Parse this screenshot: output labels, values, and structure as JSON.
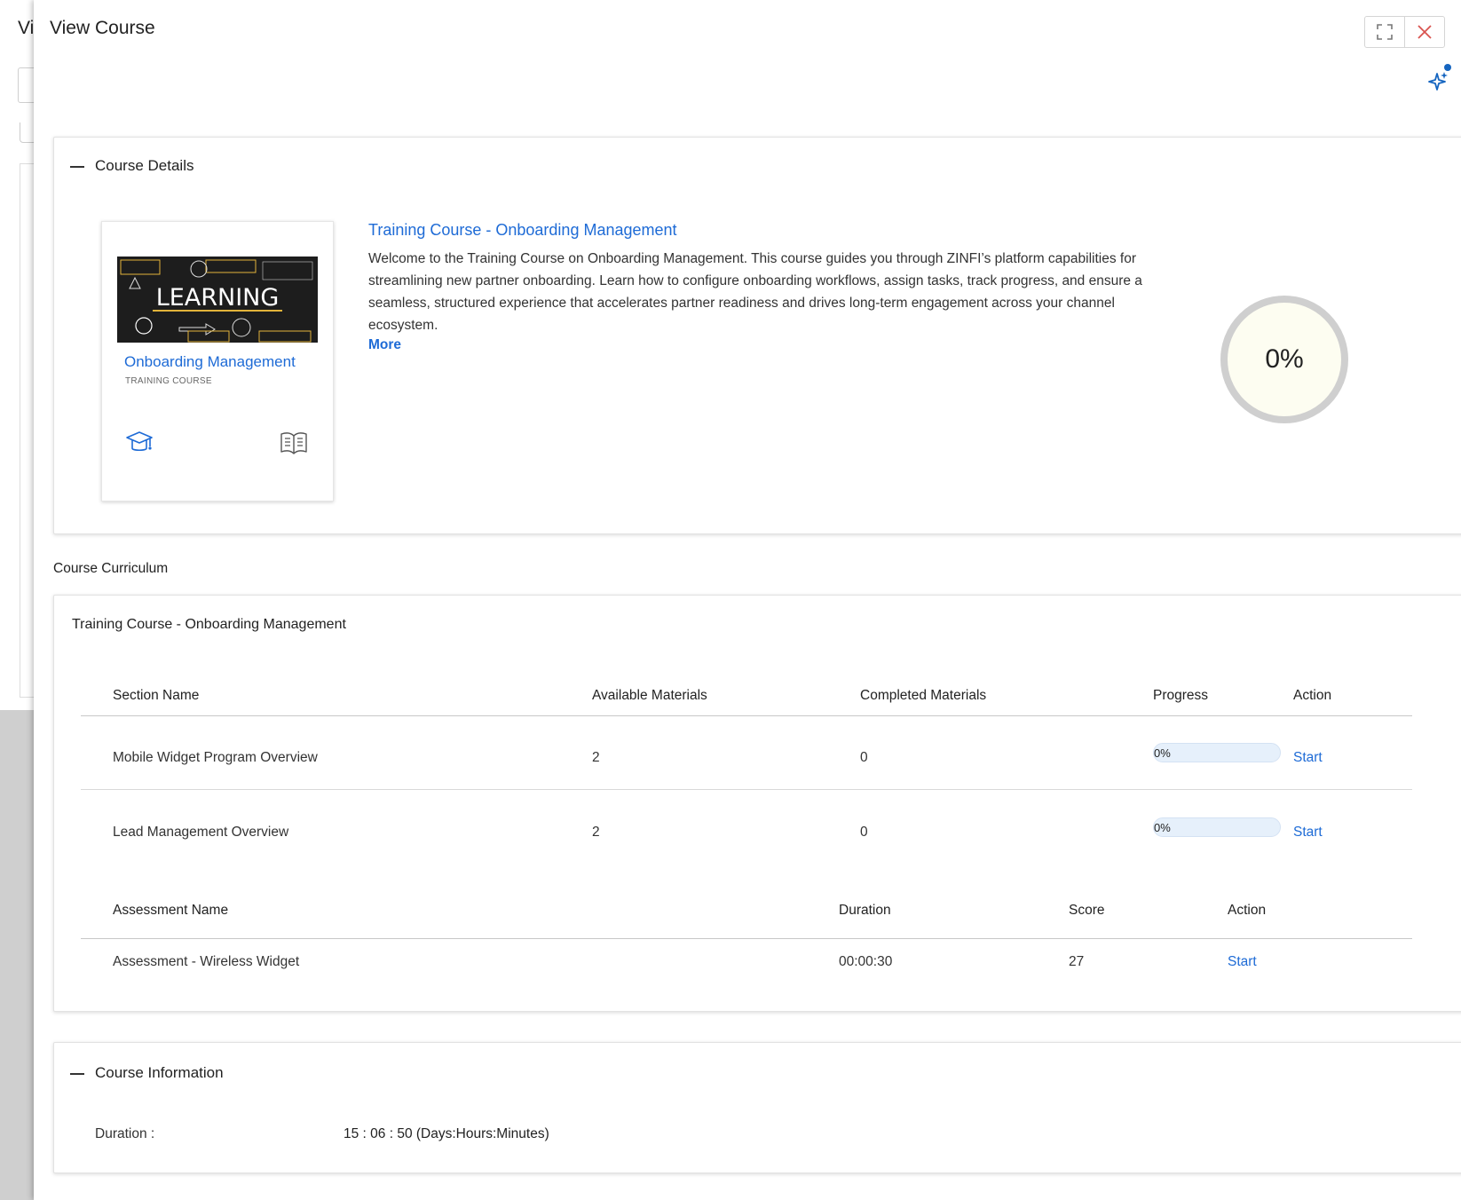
{
  "background_page": {
    "title_fragment": "Vi"
  },
  "modal": {
    "title": "View Course"
  },
  "course_details": {
    "heading": "Course Details",
    "tile": {
      "image_text": "LEARNING",
      "title": "Onboarding Management",
      "subtitle": "TRAINING COURSE"
    },
    "course_title": "Training Course - Onboarding Management",
    "description": "Welcome to the Training Course on Onboarding Management. This course guides you through ZINFI’s platform capabilities for streamlining new partner onboarding. Learn how to configure onboarding workflows, assign tasks, track progress, and ensure a seamless, structured experience that accelerates partner readiness and drives long-term engagement across your channel ecosystem.",
    "more_label": "More",
    "progress_label": "0%"
  },
  "curriculum": {
    "label": "Course Curriculum",
    "card_title": "Training Course - Onboarding Management",
    "sections_header": {
      "name": "Section Name",
      "available": "Available Materials",
      "completed": "Completed Materials",
      "progress": "Progress",
      "action": "Action"
    },
    "sections": [
      {
        "name": "Mobile Widget Program Overview",
        "available": "2",
        "completed": "0",
        "progress": "0%",
        "progress_value": 0,
        "action": "Start"
      },
      {
        "name": "Lead Management Overview",
        "available": "2",
        "completed": "0",
        "progress": "0%",
        "progress_value": 0,
        "action": "Start"
      }
    ],
    "assessments_header": {
      "name": "Assessment Name",
      "duration": "Duration",
      "score": "Score",
      "action": "Action"
    },
    "assessments": [
      {
        "name": "Assessment - Wireless Widget",
        "duration": "00:00:30",
        "score": "27",
        "action": "Start"
      }
    ]
  },
  "course_information": {
    "heading": "Course Information",
    "duration_label": "Duration :",
    "duration_value": "15 : 06 : 50 (Days:Hours:Minutes)"
  },
  "colors": {
    "accent": "#1e6bd6",
    "close_icon": "#d9534f",
    "progress_bar_bg": "#e6f0fb",
    "progress_ring": "#cfcfcf"
  },
  "icons": {
    "expand": "fullscreen-icon",
    "close": "close-icon",
    "assistant": "sparkle-icon",
    "collapse": "minus-icon",
    "course": "graduation-cap-icon",
    "materials": "open-book-icon"
  }
}
